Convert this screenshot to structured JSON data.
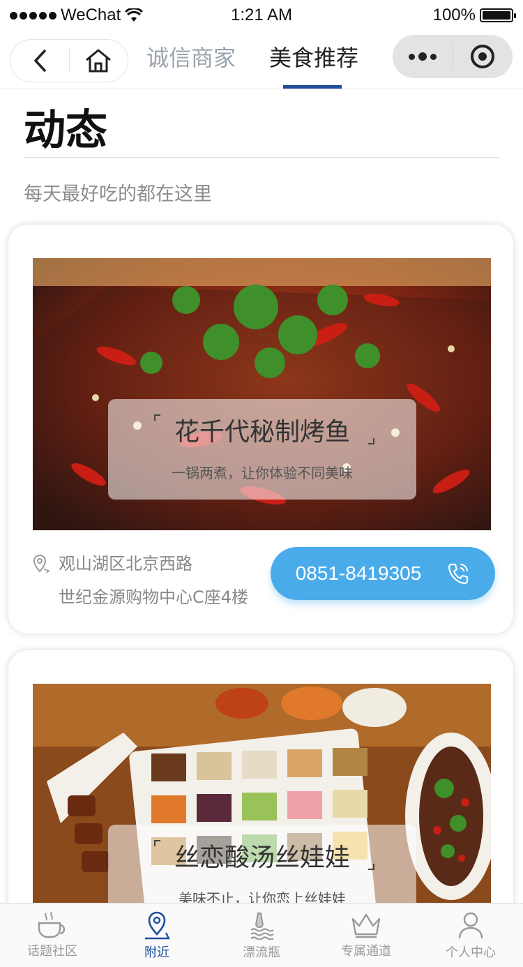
{
  "status_bar": {
    "carrier": "WeChat",
    "time": "1:21 AM",
    "battery": "100%",
    "battery_level": 1.0
  },
  "nav": {
    "tabs": [
      {
        "label": "诚信商家",
        "active": false
      },
      {
        "label": "美食推荐",
        "active": true
      }
    ],
    "back_icon": "chevron-left-icon",
    "home_icon": "home-icon"
  },
  "page": {
    "title": "动态",
    "subtitle": "每天最好吃的都在这里"
  },
  "restaurants": [
    {
      "name": "花千代秘制烤鱼",
      "slogan": "一锅两煮，让你体验不同美味",
      "address_line1": "观山湖区北京西路",
      "address_line2": "世纪金源购物中心C座4楼",
      "phone": "0851-8419305"
    },
    {
      "name": "丝恋酸汤丝娃娃",
      "slogan": "美味不止，让你恋上丝娃娃"
    }
  ],
  "tabbar": [
    {
      "label": "话题社区",
      "icon": "coffee-cup-icon",
      "active": false
    },
    {
      "label": "附近",
      "icon": "location-pin-icon",
      "active": true
    },
    {
      "label": "漂流瓶",
      "icon": "bottle-waves-icon",
      "active": false
    },
    {
      "label": "专属通道",
      "icon": "crown-icon",
      "active": false
    },
    {
      "label": "个人中心",
      "icon": "user-icon",
      "active": false
    }
  ],
  "colors": {
    "accent": "#1f4e9c",
    "phone_button": "#4aabea"
  }
}
